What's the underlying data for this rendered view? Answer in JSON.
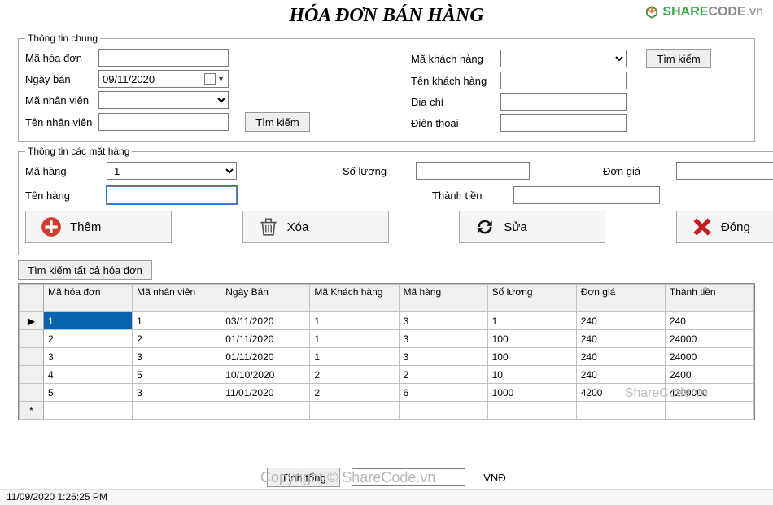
{
  "title": "HÓA ĐƠN BÁN HÀNG",
  "logo": {
    "share": "SHARE",
    "code": "CODE",
    "vn": ".vn"
  },
  "group1": {
    "legend": "Thông tin chung",
    "ma_hoa_don_lbl": "Mã hóa đơn",
    "ma_hoa_don": "",
    "ngay_ban_lbl": "Ngày bán",
    "ngay_ban": "09/11/2020",
    "ma_nv_lbl": "Mã nhân viên",
    "ma_nv": "",
    "ten_nv_lbl": "Tên nhân viên",
    "ten_nv": "",
    "tim_kiem": "Tìm kiếm",
    "ma_kh_lbl": "Mã khách hàng",
    "ma_kh": "",
    "ten_kh_lbl": "Tên khách hàng",
    "ten_kh": "",
    "dia_chi_lbl": "Địa chỉ",
    "dia_chi": "",
    "dien_thoai_lbl": "Điện thoại",
    "dien_thoai": "",
    "tim_kiem2": "Tìm kiếm"
  },
  "group2": {
    "legend": "Thông tin các mặt hàng",
    "ma_hang_lbl": "Mã hàng",
    "ma_hang": "1",
    "so_luong_lbl": "Số lượng",
    "so_luong": "",
    "don_gia_lbl": "Đơn giá",
    "don_gia": "",
    "ten_hang_lbl": "Tên hàng",
    "ten_hang": "",
    "thanh_tien_lbl": "Thành tiền",
    "thanh_tien": "",
    "them": "Thêm",
    "xoa": "Xóa",
    "sua": "Sửa",
    "dong": "Đóng"
  },
  "search_all": "Tìm kiếm tất cả hóa đơn",
  "table": {
    "headers": [
      "Mã hóa đơn",
      "Mã nhân viên",
      "Ngày Bán",
      "Mã Khách hàng",
      "Mã hàng",
      "Số lượng",
      "Đơn giá",
      "Thành tiền"
    ],
    "rows": [
      [
        "1",
        "1",
        "03/11/2020",
        "1",
        "3",
        "1",
        "240",
        "240"
      ],
      [
        "2",
        "2",
        "01/11/2020",
        "1",
        "3",
        "100",
        "240",
        "24000"
      ],
      [
        "3",
        "3",
        "01/11/2020",
        "1",
        "3",
        "100",
        "240",
        "24000"
      ],
      [
        "4",
        "5",
        "10/10/2020",
        "2",
        "2",
        "10",
        "240",
        "2400"
      ],
      [
        "5",
        "3",
        "11/01/2020",
        "2",
        "6",
        "1000",
        "4200",
        "4200000"
      ]
    ],
    "row_indicators": [
      "▶",
      "",
      "",
      "",
      "",
      "*"
    ]
  },
  "footer": {
    "tinh_tong": "Tính tổng",
    "total": "",
    "vnd": "VNĐ"
  },
  "watermarks": {
    "copy": "Copyright © ShareCode.vn",
    "side": "ShareCode.vn"
  },
  "status": "11/09/2020 1:26:25 PM"
}
